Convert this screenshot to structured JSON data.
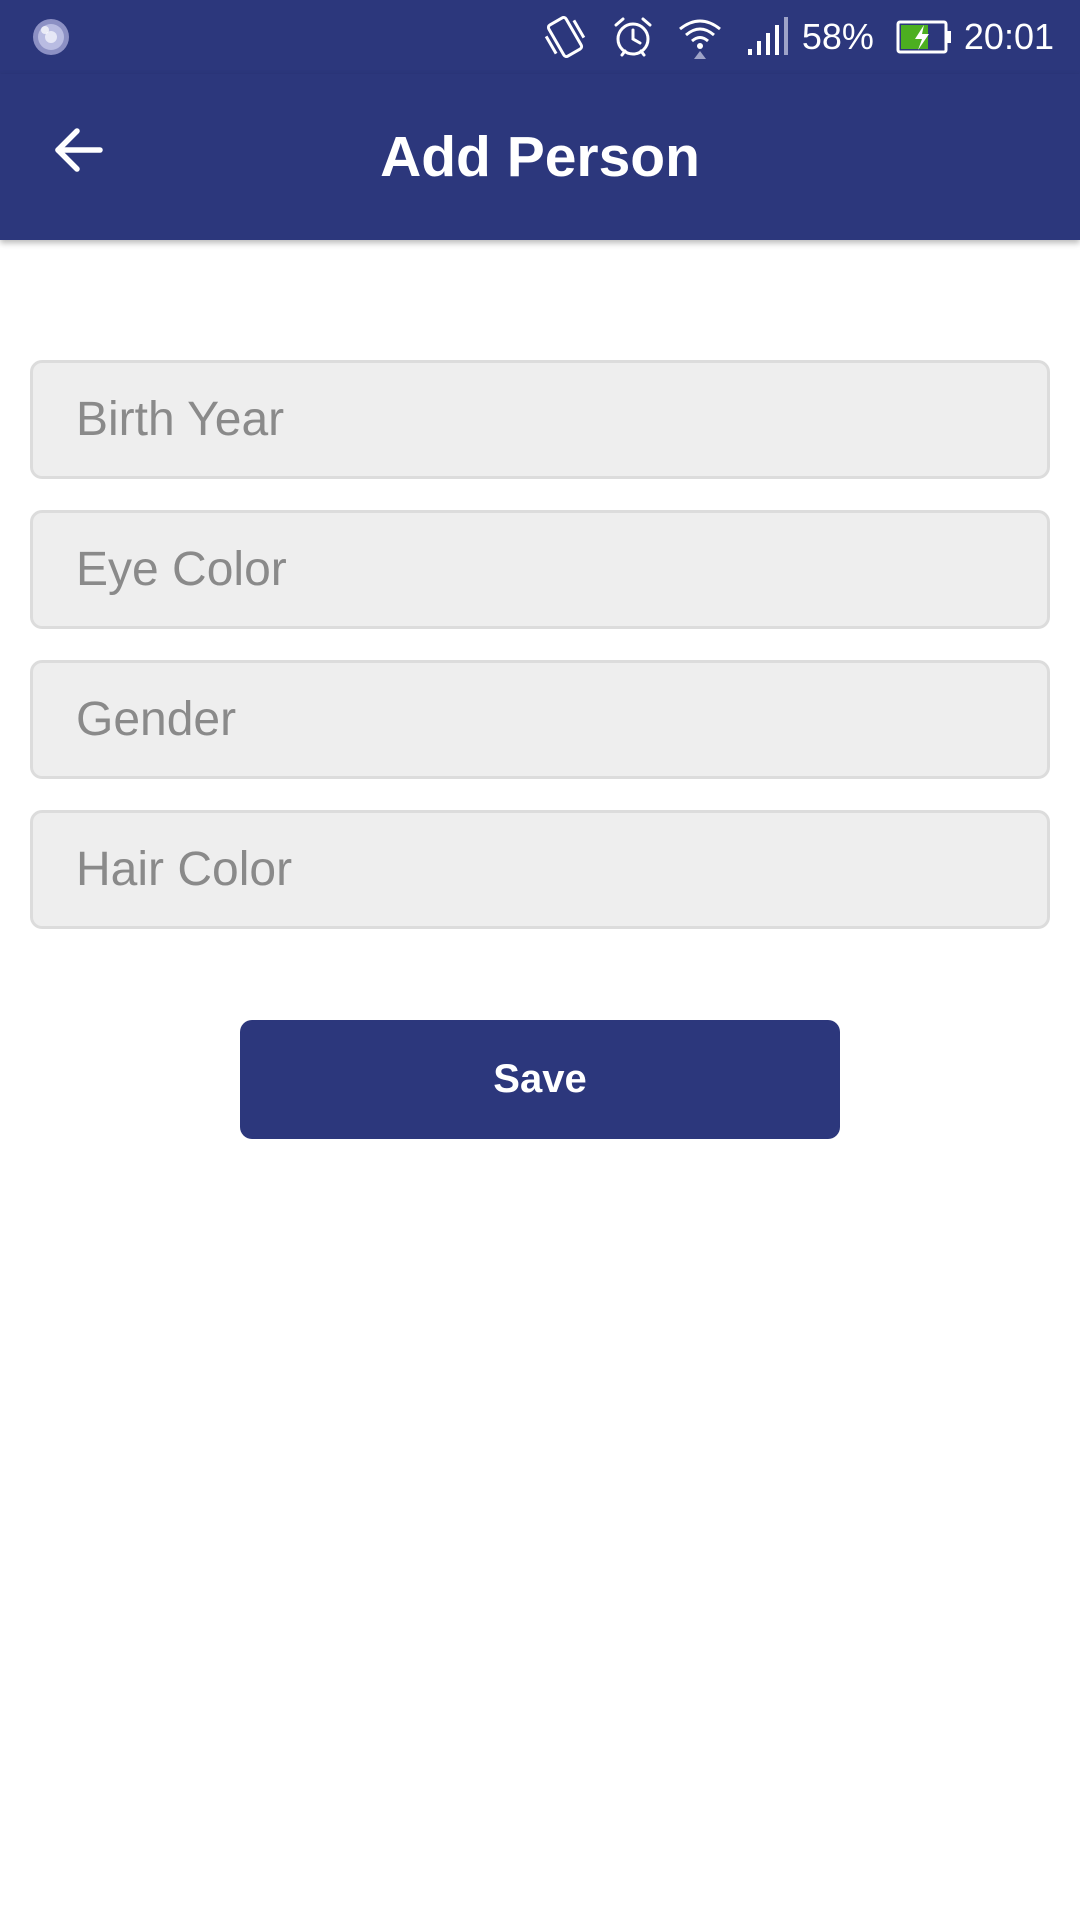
{
  "status_bar": {
    "left_icon": "app-notification-icon",
    "icons": [
      "vibrate-icon",
      "alarm-icon",
      "wifi-icon",
      "cellular-signal-icon"
    ],
    "battery_percent": "58%",
    "battery_icon": "battery-charging-icon",
    "time": "20:01"
  },
  "app_bar": {
    "back_icon": "arrow-back-icon",
    "title": "Add Person",
    "background_color": "#2c377c"
  },
  "form": {
    "fields": [
      {
        "name": "birth-year-input",
        "placeholder": "Birth Year",
        "value": ""
      },
      {
        "name": "eye-color-input",
        "placeholder": "Eye Color",
        "value": ""
      },
      {
        "name": "gender-input",
        "placeholder": "Gender",
        "value": ""
      },
      {
        "name": "hair-color-input",
        "placeholder": "Hair Color",
        "value": ""
      }
    ],
    "save_label": "Save"
  },
  "colors": {
    "primary": "#2c377c",
    "field_background": "#eeeeee",
    "field_border": "#dcdcdc",
    "placeholder_text": "#8a8a8a",
    "battery_fill": "#4caf20"
  }
}
